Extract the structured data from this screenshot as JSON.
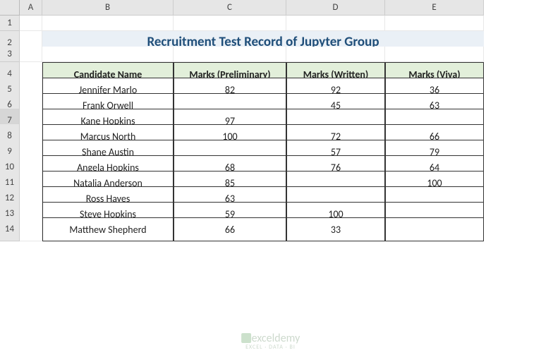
{
  "columns": [
    "A",
    "B",
    "C",
    "D",
    "E"
  ],
  "row_numbers": [
    1,
    2,
    3,
    4,
    5,
    6,
    7,
    8,
    9,
    10,
    11,
    12,
    13,
    14
  ],
  "selected_row": 7,
  "title": "Recruitment Test Record of Jupyter Group",
  "table": {
    "headers": [
      "Candidate Name",
      "Marks (Preliminary)",
      "Marks (Written)",
      "Marks (Viva)"
    ],
    "rows": [
      {
        "name": "Jennifer Marlo",
        "prelim": "82",
        "written": "92",
        "viva": "36"
      },
      {
        "name": "Frank Orwell",
        "prelim": "",
        "written": "45",
        "viva": "63"
      },
      {
        "name": "Kane Hopkins",
        "prelim": "97",
        "written": "",
        "viva": ""
      },
      {
        "name": "Marcus North",
        "prelim": "100",
        "written": "72",
        "viva": "66"
      },
      {
        "name": "Shane Austin",
        "prelim": "",
        "written": "57",
        "viva": "79"
      },
      {
        "name": "Angela Hopkins",
        "prelim": "68",
        "written": "76",
        "viva": "64"
      },
      {
        "name": "Natalia Anderson",
        "prelim": "85",
        "written": "",
        "viva": "100"
      },
      {
        "name": "Ross Hayes",
        "prelim": "63",
        "written": "",
        "viva": ""
      },
      {
        "name": "Steve Hopkins",
        "prelim": "59",
        "written": "100",
        "viva": ""
      },
      {
        "name": "Matthew Shepherd",
        "prelim": "66",
        "written": "33",
        "viva": ""
      }
    ]
  },
  "watermark": {
    "main": "exceldemy",
    "sub": "EXCEL · DATA · BI"
  }
}
